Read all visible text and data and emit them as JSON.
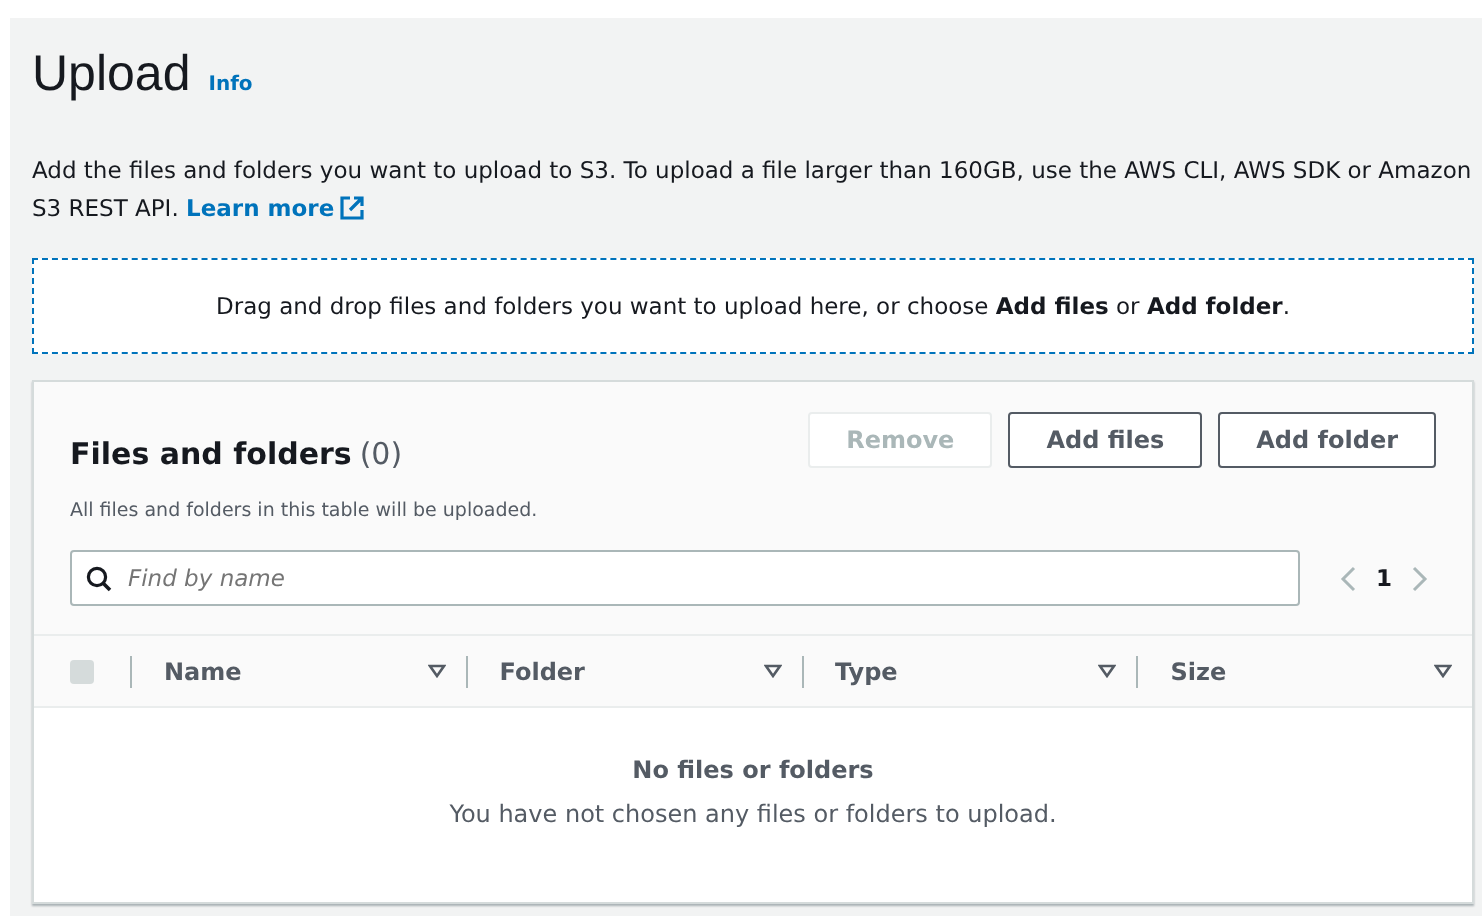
{
  "header": {
    "title": "Upload",
    "info_link": "Info"
  },
  "description": {
    "text": "Add the files and folders you want to upload to S3. To upload a file larger than 160GB, use the AWS CLI, AWS SDK or Amazon S3 REST API.",
    "link": "Learn more"
  },
  "drop_zone": {
    "text": "Drag and drop files and folders you want to upload here, or choose **Add files** or **Add folder**."
  },
  "panel": {
    "title": "Files and folders",
    "count": "(0)",
    "subtitle": "All files and folders in this table will be uploaded.",
    "buttons": [
      {
        "label": "Remove",
        "disabled": true
      },
      {
        "label": "Add files",
        "disabled": false
      },
      {
        "label": "Add folder",
        "disabled": false
      }
    ],
    "search": {
      "placeholder": "Find by name"
    },
    "pagination": {
      "page": "1"
    },
    "table": {
      "select_all": {
        "disabled": true
      },
      "columns": [
        "Name",
        "Folder",
        "Type",
        "Size"
      ],
      "empty": {
        "title": "No files or folders",
        "message": "You have not chosen any files or folders to upload."
      }
    }
  }
}
